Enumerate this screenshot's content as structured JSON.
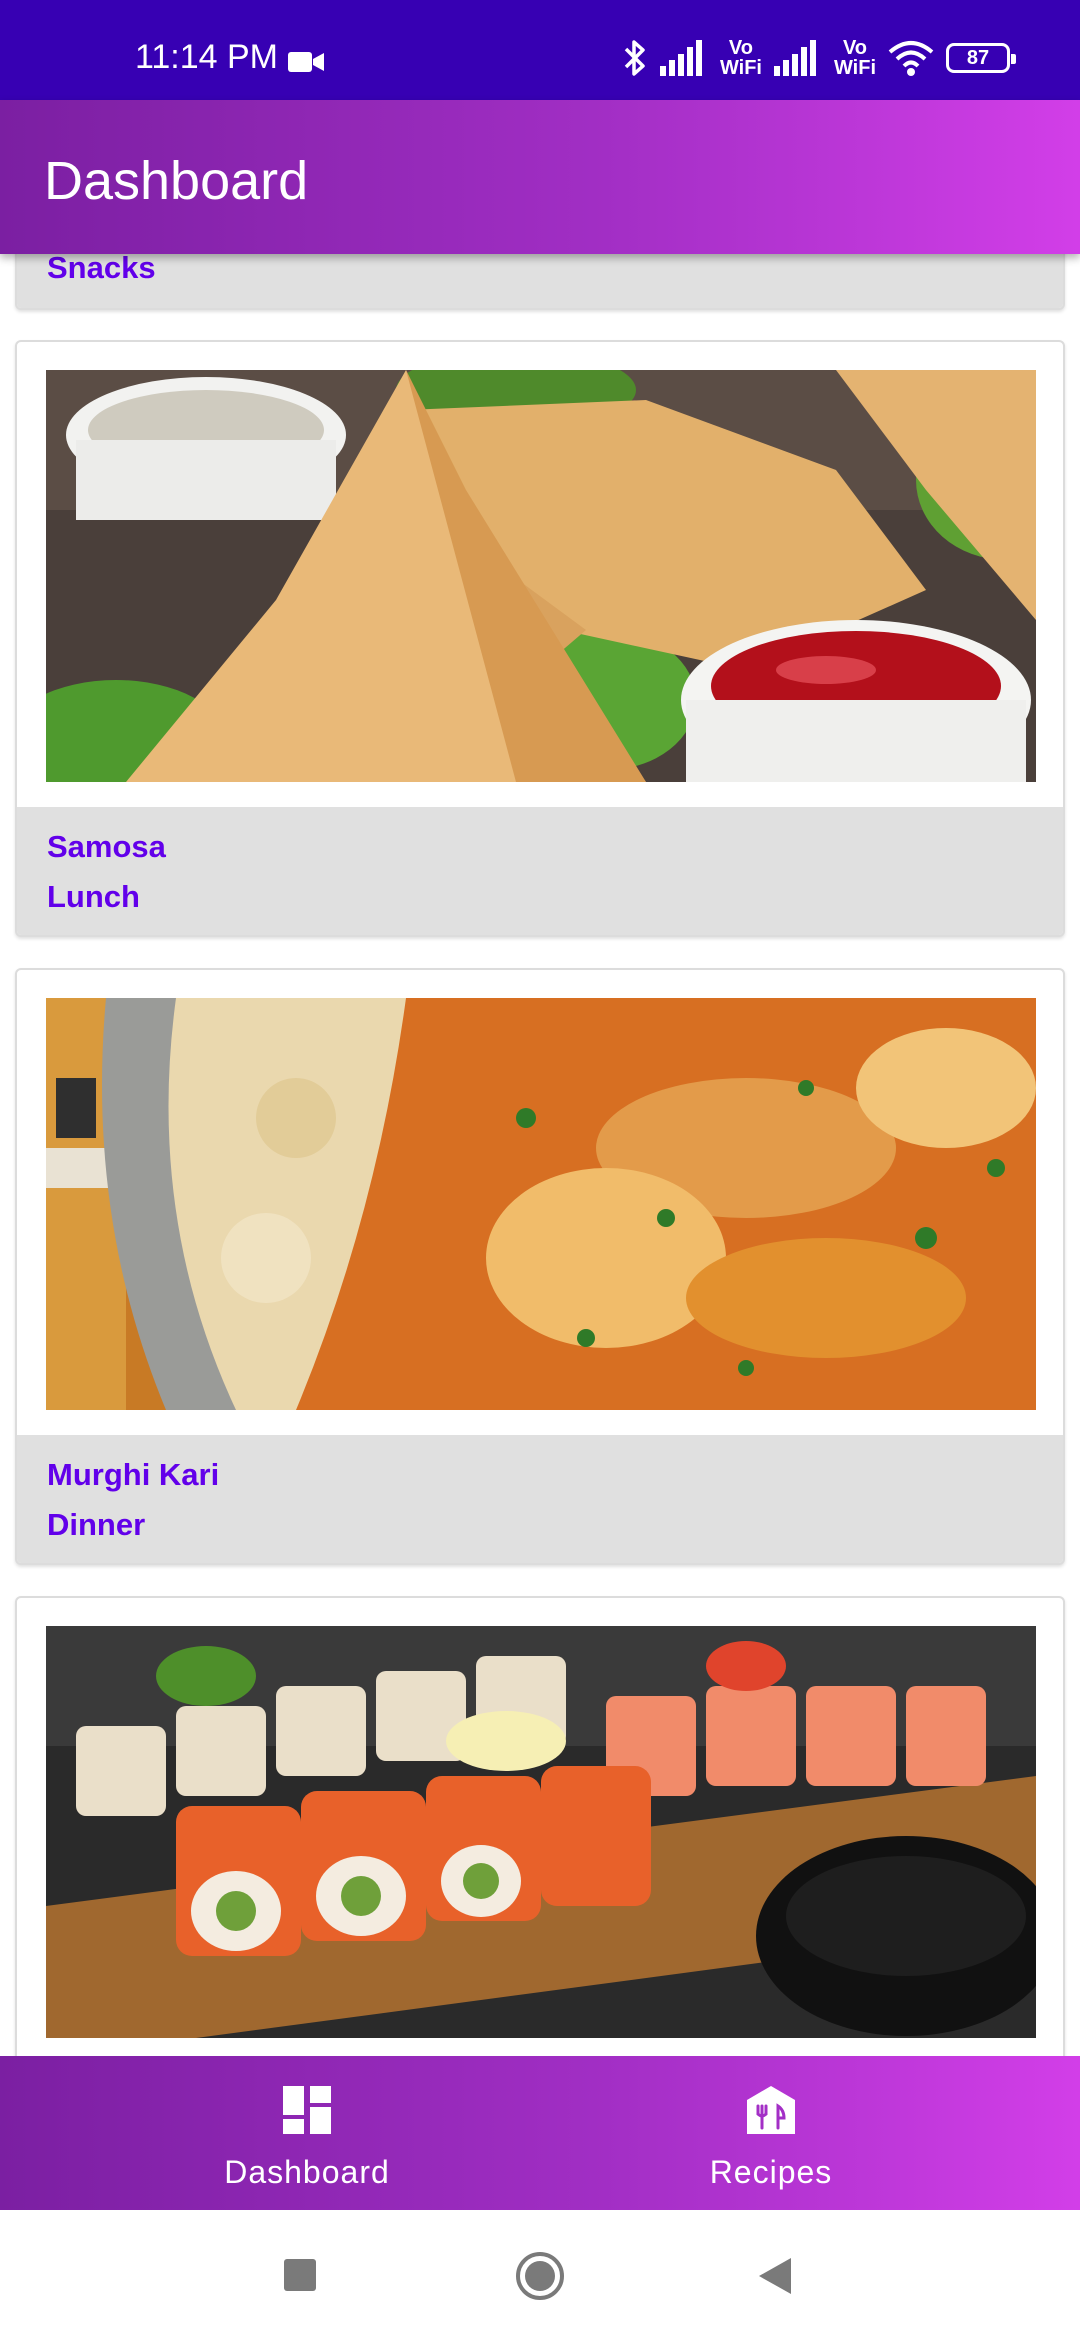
{
  "status_bar": {
    "time": "11:14 PM",
    "vo_wifi_label": "Vo\nWiFi",
    "battery": "87",
    "icons": [
      "video-camera-icon",
      "bluetooth-icon",
      "signal-icon",
      "vowifi-icon",
      "wifi-icon",
      "battery-icon"
    ]
  },
  "app_bar": {
    "title": "Dashboard"
  },
  "cards": [
    {
      "lines": [
        "Snacks"
      ],
      "image": null
    },
    {
      "lines": [
        "Samosa",
        "Lunch"
      ],
      "image": "samosa-photo"
    },
    {
      "lines": [
        "Murghi Kari",
        "Dinner"
      ],
      "image": "curry-rice-photo"
    },
    {
      "lines": [],
      "image": "sushi-photo"
    }
  ],
  "bottom_nav": {
    "items": [
      {
        "label": "Dashboard",
        "icon": "dashboard-icon"
      },
      {
        "label": "Recipes",
        "icon": "recipes-icon"
      }
    ]
  },
  "system_nav": {
    "icons": [
      "recent-apps-icon",
      "home-icon",
      "back-icon"
    ]
  },
  "colors": {
    "status_bar": "#3700b3",
    "gradient_start": "#7b1fa2",
    "gradient_end": "#d23ee8",
    "card_text": "#6200ea",
    "card_footer": "#e0e0e0"
  }
}
